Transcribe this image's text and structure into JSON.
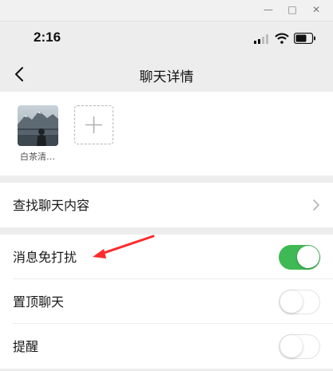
{
  "phone_status": {
    "time": "2:16"
  },
  "header": {
    "title": "聊天详情",
    "back_icon": "chevron-left-icon"
  },
  "members": [
    {
      "name": "白茶清…",
      "avatar": "landscape-photo"
    }
  ],
  "add_member_icon": "plus-icon",
  "search_row": {
    "label": "查找聊天内容"
  },
  "settings": [
    {
      "label": "消息免打扰",
      "on": true
    },
    {
      "label": "置顶聊天",
      "on": false
    },
    {
      "label": "提醒",
      "on": false
    }
  ],
  "colors": {
    "toggle_on": "#3fb954",
    "annotation_arrow": "#ff2a2a"
  }
}
